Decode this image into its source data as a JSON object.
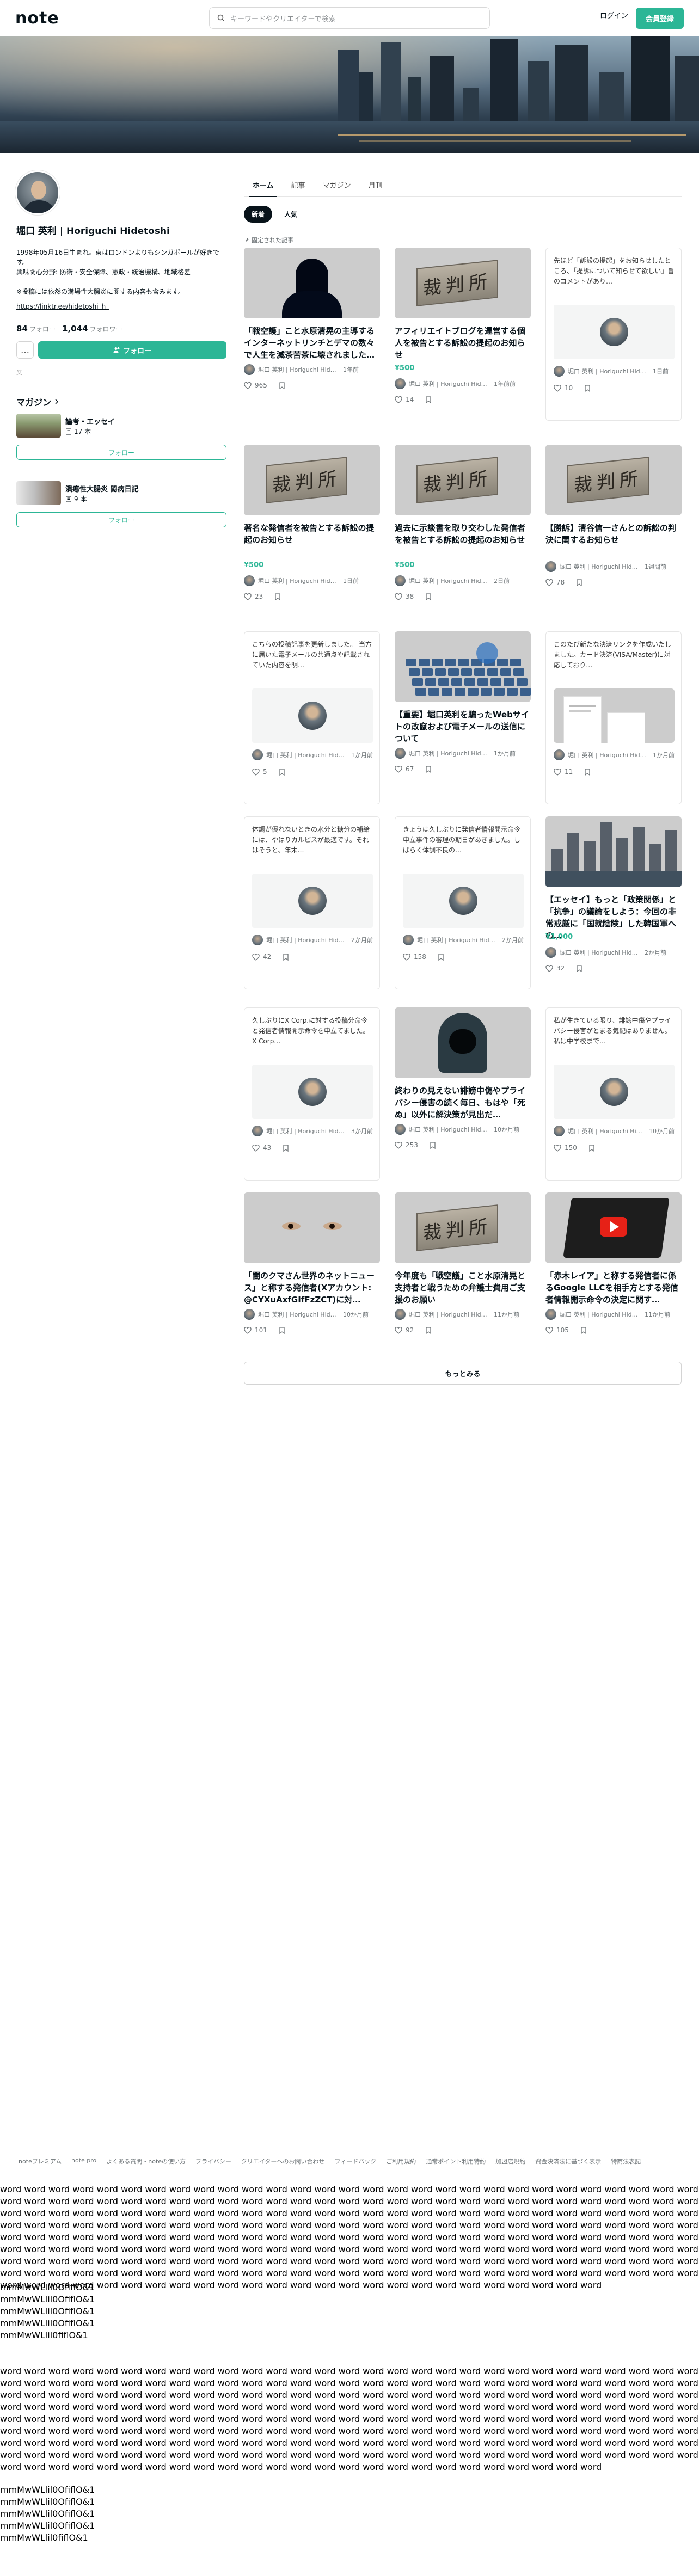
{
  "header": {
    "logo": "note",
    "search_placeholder": "キーワードやクリエイターで検索",
    "login": "ログイン",
    "signup": "会員登録"
  },
  "profile": {
    "name": "堀口 英利 | Horiguchi Hidetoshi",
    "bio": "1998年05月16日生まれ。東はロンドンよりもシンガポールが好きです。\n興味関心分野: 防衛・安全保障、憲政・統治機構、地域格差\n\n※投稿には依然の満場性大腸炎に関する内容も含みます。",
    "link": "https://linktr.ee/hidetoshi_h_",
    "follow_count": "84",
    "follow_label": "フォロー",
    "follower_count": "1,044",
    "follower_label": "フォロワー",
    "more_button": "…",
    "follow_button": "フォロー",
    "small_mark": "又"
  },
  "magazines": {
    "heading": "マガジン",
    "items": [
      {
        "title": "論考・エッセイ",
        "count": "17 本",
        "follow": "フォロー"
      },
      {
        "title": "潰瘍性大腸炎 闘病日記",
        "count": "9 本",
        "follow": "フォロー"
      }
    ]
  },
  "tabs": [
    "ホーム",
    "記事",
    "マガジン",
    "月刊"
  ],
  "sort": [
    "新着",
    "人気"
  ],
  "pinned_label": "固定された記事",
  "articles": [
    {
      "type": "image",
      "image": "hacker",
      "title": "「戦空護」こと水原清晃の主導するインターネットリンチとデマの数々で人生を滅茶苦茶に壊されました…",
      "price": "",
      "author": "堀口 英利 | Horiguchi Hidetoshi",
      "date": "1年前",
      "likes": "965"
    },
    {
      "type": "image",
      "image": "court",
      "title": "アフィリエイトブログを運営する個人を被告とする訴訟の提起のお知らせ",
      "price": "¥500",
      "author": "堀口 英利 | Horiguchi Hidetoshi",
      "date": "1年前前",
      "likes": "14"
    },
    {
      "type": "text",
      "excerpt": "先ほど「訴訟の提起」をお知らせしたところ、「提訴について知らせて欲しい」旨のコメントがあり…",
      "title": "",
      "price": "",
      "author": "堀口 英利 | Horiguchi Hidetoshi",
      "date": "1日前",
      "likes": "10"
    },
    {
      "type": "image",
      "image": "court",
      "title": "著名な発信者を被告とする訴訟の提起のお知らせ",
      "price": "¥500",
      "author": "堀口 英利 | Horiguchi Hidetoshi",
      "date": "1日前",
      "likes": "23"
    },
    {
      "type": "image",
      "image": "court",
      "title": "過去に示談書を取り交わした発信者を被告とする訴訟の提起のお知らせ",
      "price": "¥500",
      "author": "堀口 英利 | Horiguchi Hidetoshi",
      "date": "2日前",
      "likes": "38"
    },
    {
      "type": "image",
      "image": "court",
      "title": "【勝訴】清谷信一さんとの訴訟の判決に関するお知らせ",
      "price": "",
      "author": "堀口 英利 | Horiguchi Hidetoshi",
      "date": "1週間前",
      "likes": "78"
    },
    {
      "type": "text",
      "excerpt": "こちらの投稿記事を更新しました。 当方に届いた電子メールの共通点や記載されていた内容を明…",
      "title": "",
      "price": "",
      "author": "堀口 英利 | Horiguchi Hidetoshi",
      "date": "1か月前",
      "likes": "5"
    },
    {
      "type": "image",
      "image": "keyboard",
      "title": "【重要】堀口英利を騙ったWebサイトの改竄および電子メールの送信について",
      "price": "",
      "author": "堀口 英利 | Horiguchi Hidetoshi",
      "date": "1か月前",
      "likes": "67"
    },
    {
      "type": "image",
      "image": "doc",
      "title": "",
      "excerpt": "このたび新たな決済リンクを作成いたしました。カード決済(VISA/Master)に対応しており…",
      "price": "",
      "author": "堀口 英利 | Horiguchi Hidetoshi",
      "date": "1か月前",
      "likes": "11"
    },
    {
      "type": "text",
      "excerpt": "体調が優れないときの水分と糖分の補給には、やはりカルピスが最適です。それはそうと、年末…",
      "title": "",
      "price": "",
      "author": "堀口 英利 | Horiguchi Hidetoshi",
      "date": "2か月前",
      "likes": "42"
    },
    {
      "type": "text",
      "excerpt": "きょうは久しぶりに発信者情報開示命令申立事件の審理の期日があきました。しばらく体調不良の…",
      "title": "",
      "price": "",
      "author": "堀口 英利 | Horiguchi Hidetoshi",
      "date": "2か月前",
      "likes": "158"
    },
    {
      "type": "image",
      "image": "city",
      "title": "【エッセイ】もっと「政策関係」と「抗争」の議論をしよう：今回の非常戒厳に「国就陰険」した韓国軍への…",
      "price": "¥1,000",
      "author": "堀口 英利 | Horiguchi Hidetoshi",
      "date": "2か月前",
      "likes": "32"
    },
    {
      "type": "text",
      "excerpt": "久しぶりにX Corp.に対する投稿分命令と発信者情報開示命令を申立てました。X Corp…",
      "title": "",
      "price": "",
      "author": "堀口 英利 | Horiguchi Hidetoshi",
      "date": "3か月前",
      "likes": "43"
    },
    {
      "type": "image",
      "image": "hood",
      "title": "終わりの見えない誹謗中傷やプライバシー侵害の続く毎日、もはや「死ぬ」以外に解決策が見出だ…",
      "price": "",
      "author": "堀口 英利 | Horiguchi Hidetoshi",
      "date": "10か月前",
      "likes": "253"
    },
    {
      "type": "text",
      "excerpt": "私が生きている限り、誹謗中傷やプライバシー侵害がとまる気配はありません。私は中学校まで…",
      "title": "",
      "price": "",
      "author": "堀口 英利 | Horiguchi Hidetoshi",
      "date": "10か月前",
      "likes": "150"
    },
    {
      "type": "image",
      "image": "eyes",
      "title": "「闇のクマさん世界のネットニュース」と称する発信者(Xアカウント: @CYXuAxfGIfFzZCT)に対…",
      "price": "",
      "author": "堀口 英利 | Horiguchi Hidetoshi",
      "date": "10か月前",
      "likes": "101"
    },
    {
      "type": "image",
      "image": "court",
      "title": "今年度も「戦空護」こと水原清晃と支持者と戦うための弁護士費用ご支援のお願い",
      "price": "",
      "author": "堀口 英利 | Horiguchi Hidetoshi",
      "date": "11か月前",
      "likes": "92"
    },
    {
      "type": "image",
      "image": "yt",
      "title": "「赤木レイア」と称する発信者に係るGoogle LLCを相手方とする発信者情報開示命令の決定に関す…",
      "price": "",
      "author": "堀口 英利 | Horiguchi Hidetoshi",
      "date": "11か月前",
      "likes": "105"
    }
  ],
  "more_button": "もっとみる",
  "footer_links": [
    "noteプレミアム",
    "note pro",
    "よくある質問・noteの使い方",
    "プライバシー",
    "クリエイターへのお問い合わせ",
    "フィードバック",
    "ご利用規約",
    "通常ポイント利用特約",
    "加盟店規約",
    "資金決済法に基づく表示",
    "特商法表記"
  ],
  "filler_text": "word word word word word word word word word word word word word word word word word word word word word word word word word word word word word word word word word word word word word word word word word word word word word word word word word word word word word word word word word word word word word word word word word word word word word word word word word word word word word word word word word word word word word word word word word word word word word word word word word word word word word word word word word word word word word word word word word word word word word word word word word word word word word word word word word word word word word word word word word word word word word word word word word word word word word word word word word word word word word word word word word word word word word word word word word word word word word word word word word word word word word word word word word word word word word word word word word word word word word word word word word word word word word word word word word word word word word word word word word word word word word word word word word word word word word word word word word word word word word word word word word word word word word word word word word word word word word word word word word",
  "glyph_lines_1": [
    "mmMwWLlil0OfiflO&1",
    "mmMwWLlil0OfiflO&1",
    "mmMwWLlil0OfiflO&1",
    "mmMwWLlil0OfiflO&1",
    "mmMwWLlil0fiflO&1"
  ],
  "glyph_lines_2": [
    "mmMwWLlil0OfiflO&1",
    "mmMwWLlil0OfiflO&1",
    "mmMwWLlil0OfiflO&1",
    "mmMwWLlil0OfiflO&1",
    "mmMwWLlil0fiflO&1"
  ]
}
